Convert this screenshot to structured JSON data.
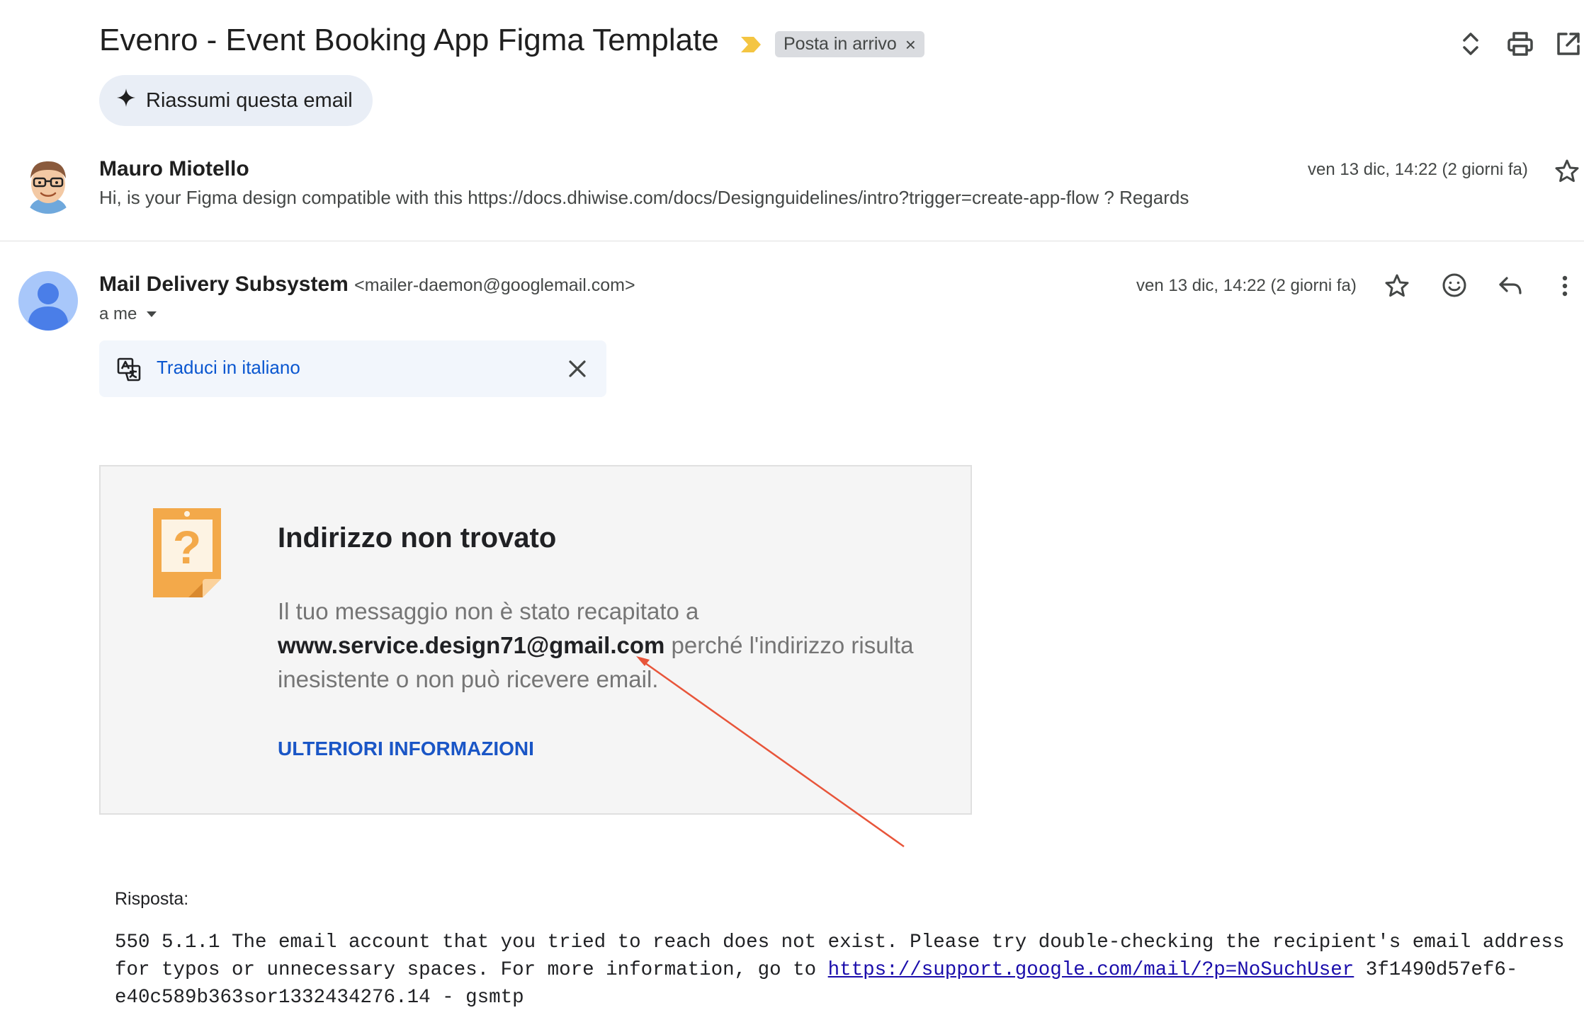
{
  "thread": {
    "subject": "Evenro - Event Booking App Figma Template",
    "label_chip": "Posta in arrivo",
    "label_chip_close": "×",
    "summarize_label": "Riassumi questa email"
  },
  "message1": {
    "sender": "Mauro Miotello",
    "snippet": "Hi, is your Figma design compatible with this https://docs.dhiwise.com/docs/Designguidelines/intro?trigger=create-app-flow ? Regards",
    "date": "ven 13 dic, 14:22 (2 giorni fa)"
  },
  "message2": {
    "sender": "Mail Delivery Subsystem",
    "email": "<mailer-daemon@googlemail.com>",
    "to": "a me",
    "date": "ven 13 dic, 14:22 (2 giorni fa)",
    "translate_label": "Traduci in italiano"
  },
  "bounce": {
    "title": "Indirizzo non trovato",
    "msg_prefix": "Il tuo messaggio non è stato recapitato a",
    "address": "www.service.design71@gmail.com",
    "msg_suffix": "perché l'indirizzo risulta inesistente o non può ricevere email.",
    "more_info": "ULTERIORI INFORMAZIONI"
  },
  "response": {
    "label": "Risposta:",
    "text_before": "550 5.1.1 The email account that you tried to reach does not exist. Please try double-checking the recipient's email address for typos or unnecessary spaces. For more information, go to ",
    "link": "https://support.google.com/mail/?p=NoSuchUser",
    "text_after": " 3f1490d57ef6-e40c589b363sor1332434276.14 - gsmtp"
  },
  "icons": {
    "label_importance": "importance-marker-icon",
    "expand_collapse": "expand-collapse-icon",
    "print": "print-icon",
    "open_new_window": "open-in-new-window-icon",
    "sparkle": "sparkle-icon",
    "star": "star-icon",
    "emoji": "emoji-icon",
    "reply": "reply-icon",
    "more": "more-vertical-icon",
    "translate": "translate-icon",
    "close": "close-icon",
    "dropdown": "dropdown-arrow-icon",
    "bounce_illustration": "question-note-icon"
  },
  "colors": {
    "accent_blue": "#0b57d0",
    "importance_yellow": "#f4c542",
    "bounce_orange": "#f3a94a",
    "arrow_annotation": "#e8553a"
  }
}
